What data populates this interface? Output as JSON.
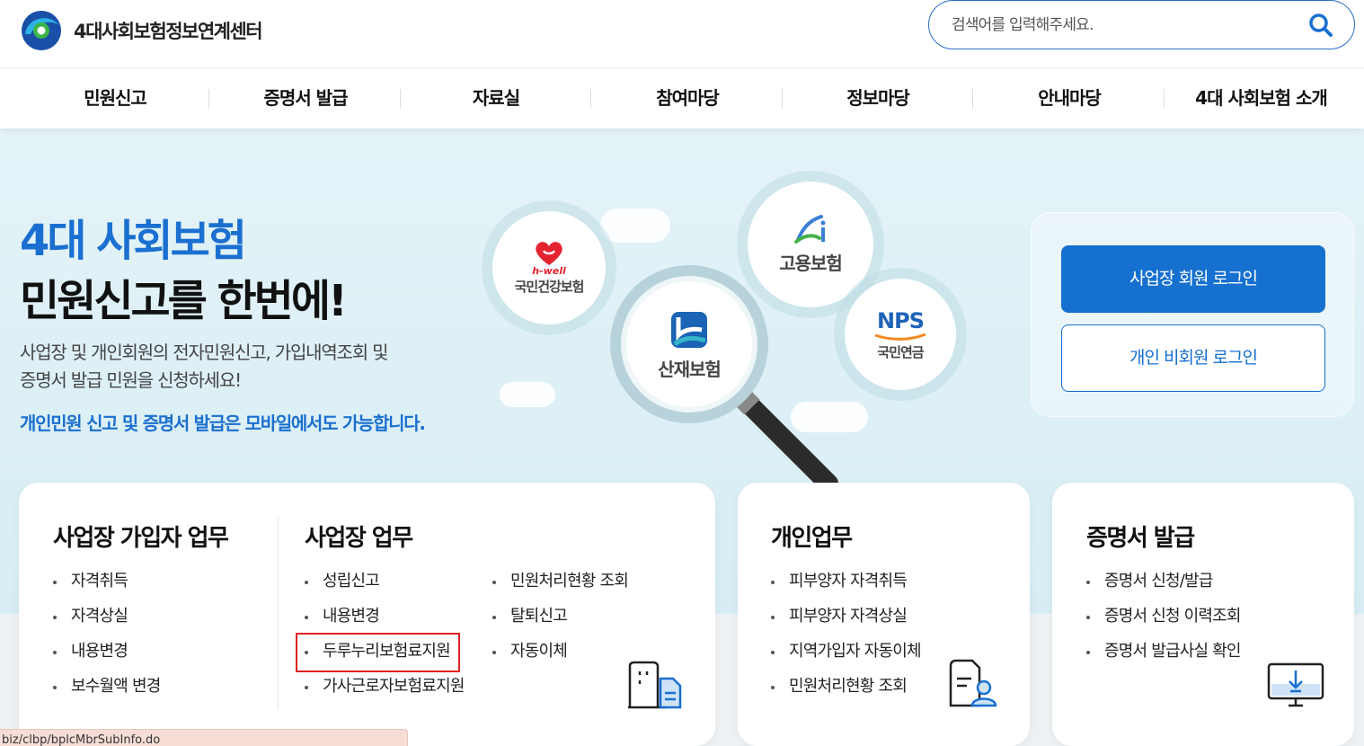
{
  "header": {
    "logo_text": "4대사회보험정보연계센터",
    "search_placeholder": "검색어를 입력해주세요."
  },
  "nav": {
    "items": [
      "민원신고",
      "증명서 발급",
      "자료실",
      "참여마당",
      "정보마당",
      "안내마당",
      "4대 사회보험 소개"
    ]
  },
  "hero": {
    "title_line1": "4대 사회보험",
    "title_line2": "민원신고를 한번에!",
    "desc_line1": "사업장 및 개인회원의 전자민원신고, 가입내역조회 및",
    "desc_line2": "증명서 발급 민원을 신청하세요!",
    "mobile_note": "개인민원 신고 및 증명서 발급은 모바일에서도 가능합니다.",
    "bubbles": {
      "health_brand": "h-well",
      "health": "국민건강보험",
      "employment": "고용보험",
      "industrial": "산재보험",
      "pension_brand": "NPS",
      "pension": "국민연금"
    }
  },
  "login": {
    "business_login": "사업장 회원 로그인",
    "personal_login": "개인 비회원 로그인"
  },
  "cards": {
    "business_subscriber": {
      "title": "사업장 가입자 업무",
      "items": [
        "자격취득",
        "자격상실",
        "내용변경",
        "보수월액 변경"
      ]
    },
    "business": {
      "title": "사업장 업무",
      "col1": [
        "성립신고",
        "내용변경",
        "두루누리보험료지원",
        "가사근로자보험료지원"
      ],
      "col2": [
        "민원처리현황 조회",
        "탈퇴신고",
        "자동이체"
      ]
    },
    "personal": {
      "title": "개인업무",
      "items": [
        "피부양자 자격취득",
        "피부양자 자격상실",
        "지역가입자 자동이체",
        "민원처리현황 조회"
      ]
    },
    "certificate": {
      "title": "증명서 발급",
      "items": [
        "증명서 신청/발급",
        "증명서 신청 이력조회",
        "증명서 발급사실 확인"
      ]
    }
  },
  "status_bar": {
    "url": "biz/clbp/bplcMbrSubInfo.do"
  },
  "colors": {
    "accent": "#1570cf",
    "highlight_box": "#e02020",
    "hero_bg": "#dcf0f6"
  }
}
